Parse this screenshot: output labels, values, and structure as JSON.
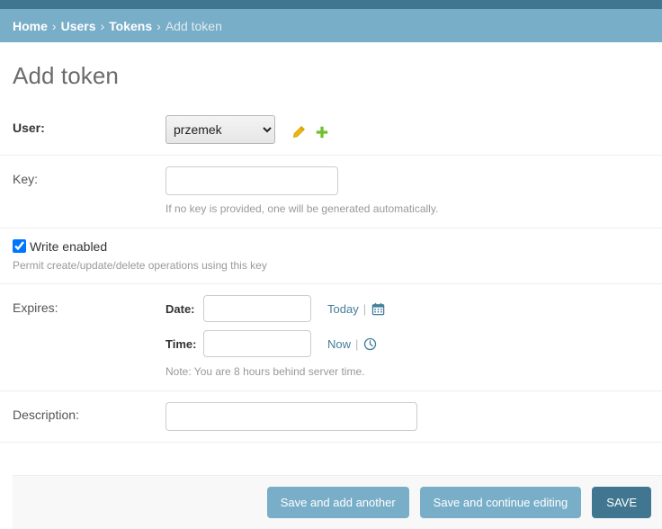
{
  "breadcrumb": {
    "items": [
      "Home",
      "Users",
      "Tokens"
    ],
    "current": "Add token",
    "separator": "›"
  },
  "page": {
    "title": "Add token"
  },
  "form": {
    "user": {
      "label": "User:",
      "selected": "przemek",
      "edit_icon": "pencil-icon",
      "add_icon": "plus-icon"
    },
    "key": {
      "label": "Key:",
      "value": "",
      "help": "If no key is provided, one will be generated automatically."
    },
    "write_enabled": {
      "label": "Write enabled",
      "checked": true,
      "help": "Permit create/update/delete operations using this key"
    },
    "expires": {
      "label": "Expires:",
      "date_label": "Date:",
      "date_value": "",
      "date_shortcut": "Today",
      "date_icon": "calendar-icon",
      "time_label": "Time:",
      "time_value": "",
      "time_shortcut": "Now",
      "time_icon": "clock-icon",
      "separator": "|",
      "note": "Note: You are 8 hours behind server time."
    },
    "description": {
      "label": "Description:",
      "value": ""
    }
  },
  "footer": {
    "save_and_add_another": "Save and add another",
    "save_and_continue": "Save and continue editing",
    "save": "SAVE"
  },
  "colors": {
    "topbar": "#417690",
    "breadcrumb_bar": "#79aec8",
    "link": "#447e9b",
    "primary_button": "#417690",
    "secondary_button": "#79aec8",
    "pencil_icon": "#efb80b",
    "plus_icon": "#70bf2b"
  }
}
